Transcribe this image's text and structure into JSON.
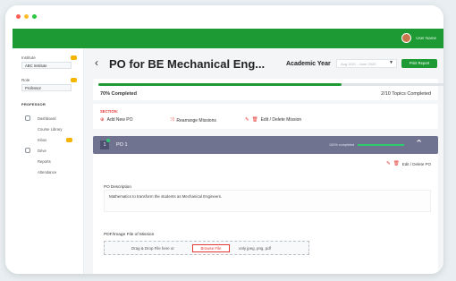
{
  "window": {
    "dot_colors": [
      "#ff5f57",
      "#ffbd2e",
      "#28c840"
    ]
  },
  "topbar": {
    "user_name": "User Name"
  },
  "sidebar": {
    "institute_label": "Institute",
    "institute_value": "ABC Institute",
    "role_label": "Role",
    "role_value": "Professor",
    "section_title": "PROFESSOR",
    "items": [
      {
        "label": "Dashboard",
        "icon": "dashboard-icon"
      },
      {
        "label": "Course Library",
        "icon": ""
      },
      {
        "label": "Inbox",
        "icon": ""
      },
      {
        "label": "Drive",
        "icon": "drive-icon"
      },
      {
        "label": "Reports",
        "icon": ""
      },
      {
        "label": "Attendance",
        "icon": ""
      }
    ]
  },
  "header": {
    "back_icon": "chevron-left-icon",
    "title": "PO for BE Mechanical Eng...",
    "academic_year_label": "Academic Year",
    "academic_year_value": "Aug 2021 - June 2022",
    "print_button": "Print Report"
  },
  "progress": {
    "percent": 70,
    "completed_label": "70% Completed",
    "topics_label": "2/10 Topics Completed"
  },
  "section": {
    "label": "SECTION:",
    "add_new_po": "Add New PO",
    "rearrange": "Rearrange Missions",
    "edit_delete": "Edit / Delete Mission"
  },
  "po": {
    "number": "1",
    "title": "PO 1",
    "completed_text": "100% completed",
    "percent": 100,
    "edit_delete": "Edit / Delete PO",
    "description_label": "PO Description",
    "description_text": "Mathematics to transform the students as Mechanical Engineers.",
    "file_label": "PDF/Image File of Mission",
    "drop_text": "Drag & Drop File here or",
    "browse_button": "Browse File",
    "extensions": "only jpeg, png, pdf"
  },
  "colors": {
    "brand_green": "#1e9a35",
    "accent_red": "#e53935",
    "po_bar": "#6f7390"
  }
}
